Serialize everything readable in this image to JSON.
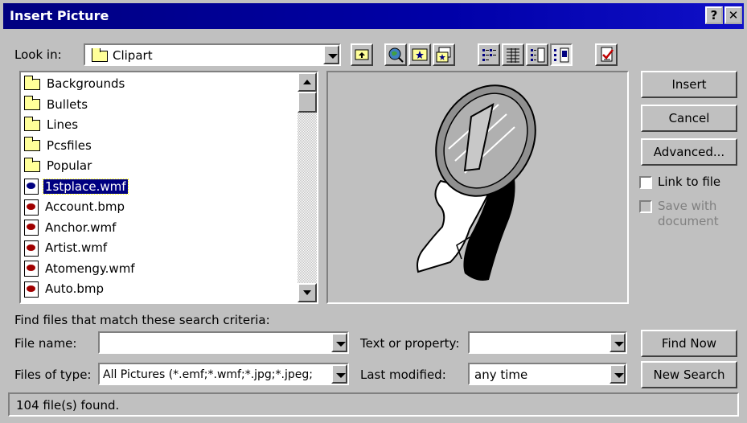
{
  "dialog": {
    "title": "Insert Picture",
    "help_label": "?",
    "close_label": "✕"
  },
  "look_in": {
    "label": "Look in:",
    "value": "Clipart"
  },
  "toolbar": {
    "icons": [
      "up-one-level-icon",
      "search-web-icon",
      "favorites-icon",
      "add-to-favorites-icon",
      "list-view-icon",
      "details-view-icon",
      "properties-view-icon",
      "preview-view-icon",
      "commands-icon"
    ]
  },
  "files": [
    {
      "name": "Backgrounds",
      "type": "folder"
    },
    {
      "name": "Bullets",
      "type": "folder"
    },
    {
      "name": "Lines",
      "type": "folder"
    },
    {
      "name": "Pcsfiles",
      "type": "folder"
    },
    {
      "name": "Popular",
      "type": "folder"
    },
    {
      "name": "1stplace.wmf",
      "type": "file",
      "selected": true
    },
    {
      "name": "Account.bmp",
      "type": "file"
    },
    {
      "name": "Anchor.wmf",
      "type": "file"
    },
    {
      "name": "Artist.wmf",
      "type": "file"
    },
    {
      "name": "Atomengy.wmf",
      "type": "file"
    },
    {
      "name": "Auto.bmp",
      "type": "file"
    }
  ],
  "buttons": {
    "insert": "Insert",
    "cancel": "Cancel",
    "advanced": "Advanced...",
    "find_now": "Find Now",
    "new_search": "New Search"
  },
  "options": {
    "link_to_file": "Link to file",
    "save_with_document_1": "Save with",
    "save_with_document_2": "document"
  },
  "search": {
    "heading": "Find files that match these search criteria:",
    "file_name_label": "File name:",
    "file_name_value": "",
    "files_of_type_label": "Files of type:",
    "files_of_type_value": "All Pictures (*.emf;*.wmf;*.jpg;*.jpeg;",
    "text_property_label": "Text or property:",
    "text_property_value": "",
    "last_modified_label": "Last modified:",
    "last_modified_value": "any time"
  },
  "status": {
    "text": "104 file(s) found."
  }
}
